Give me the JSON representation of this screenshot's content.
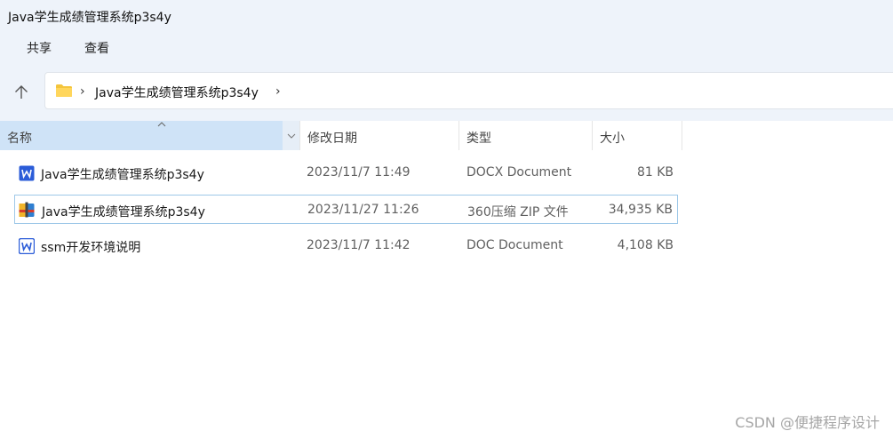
{
  "window": {
    "title": "Java学生成绩管理系统p3s4y"
  },
  "ribbon": {
    "tabs": [
      "共享",
      "查看"
    ]
  },
  "address_bar": {
    "folder_icon": "folder-icon",
    "path_segment": "Java学生成绩管理系统p3s4y"
  },
  "columns": {
    "name": "名称",
    "date_modified": "修改日期",
    "type": "类型",
    "size": "大小"
  },
  "files": [
    {
      "name": "Java学生成绩管理系统p3s4y",
      "date": "2023/11/7 11:49",
      "type": "DOCX Document",
      "size": "81 KB",
      "icon": "word-docx-icon"
    },
    {
      "name": "Java学生成绩管理系统p3s4y",
      "date": "2023/11/27 11:26",
      "type": "360压缩 ZIP 文件",
      "size": "34,935 KB",
      "icon": "zip-archive-icon"
    },
    {
      "name": "ssm开发环境说明",
      "date": "2023/11/7 11:42",
      "type": "DOC Document",
      "size": "4,108 KB",
      "icon": "word-doc-icon"
    }
  ],
  "watermark": "CSDN @便捷程序设计",
  "colors": {
    "header_bg": "#eef3fa",
    "sorted_column_bg": "#cfe3f7",
    "selection_border": "#9ec8e8",
    "folder_yellow": "#f4c53c",
    "word_blue": "#2b5cd8"
  }
}
